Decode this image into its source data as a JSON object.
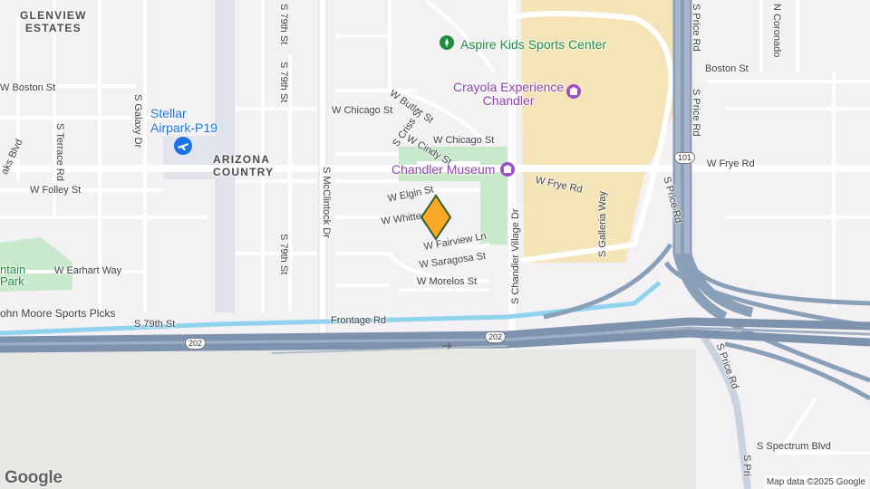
{
  "map": {
    "area_labels": {
      "glenview": "GLENVIEW\nESTATES",
      "arizona": "ARIZONA\nCOUNTRY"
    },
    "streets": {
      "w_boston_left": "W Boston St",
      "s_galaxy": "S Galaxy Dr",
      "s_terrace": "S Terrace Rd",
      "oaks_blvd": "aks Blvd",
      "w_folley": "W Folley St",
      "w_earhart": "W Earhart Way",
      "s_79th_top": "S 79th St",
      "s_79th_mid": "S 79th St",
      "s_79th_low": "S 79th St",
      "s_79th_st_road": "S 79th St",
      "s_mcclintock": "S McClintock Dr",
      "w_chicago_left": "W Chicago St",
      "w_butler": "W Butler St",
      "s_criss": "S Criss St",
      "w_cindy": "W Cindy St",
      "w_chicago_right": "W Chicago St",
      "w_elgin": "W Elgin St",
      "w_whitten": "W Whitten",
      "w_fairview": "W Fairview Ln",
      "w_saragosa": "W Saragosa St",
      "w_morelos": "W Morelos St",
      "frontage": "Frontage Rd",
      "s_chandler_village": "S Chandler Village Dr",
      "w_frye_mid": "W Frye Rd",
      "s_galleria": "S Galleria Way",
      "s_price_top": "S Price Rd",
      "boston_right": "Boston St",
      "n_coronado": "N Coronado",
      "s_price_mid": "S Price Rd",
      "w_frye_right": "W Frye Rd",
      "s_price_right": "S Price Rd",
      "s_price_bottom": "S Price Rd",
      "s_spectrum": "S Spectrum Blvd",
      "s_pri": "S Pri"
    },
    "pois": {
      "aspire": "Aspire Kids Sports Center",
      "crayola": "Crayola Experience\nChandler",
      "museum": "Chandler Museum",
      "stellar": "Stellar\nAirpark-P19",
      "park_partial": "ntain\nPark",
      "john_moore": "ohn Moore Sports Plcks"
    },
    "shields": {
      "i202_left": "202",
      "i202_right": "202",
      "i101": "101"
    },
    "icons": {
      "aspire": "sports-icon",
      "crayola": "museum-icon",
      "museum": "museum-icon",
      "airport": "airport-icon",
      "pin": "location-pin",
      "arrow": "direction-arrow-icon"
    },
    "colors": {
      "land": "#f3f1f4",
      "road": "#ffffff",
      "highway": "#8a9fb8",
      "mall": "#f5e3b5",
      "park": "#c7e8c9",
      "water": "#8fd3ee",
      "industrial": "#e9e7e3",
      "pin": "#f9a825"
    },
    "attribution": "Map data ©2025 Google",
    "brand": "Google"
  }
}
